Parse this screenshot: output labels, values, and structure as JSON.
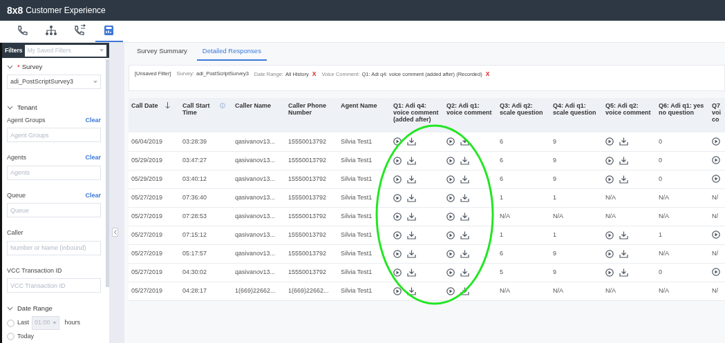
{
  "app_bar": {
    "logo": "8x8",
    "product": "Customer Experience"
  },
  "nav_icons": [
    {
      "kind": "phone",
      "selected": false
    },
    {
      "kind": "org",
      "selected": false
    },
    {
      "kind": "phone-transfer",
      "selected": false
    },
    {
      "kind": "report",
      "selected": true
    }
  ],
  "filters": {
    "label": "Filters",
    "saved_filters": {
      "placeholder": "My Saved Filters"
    },
    "sections": [
      {
        "title": "Survey",
        "required_mark": "*",
        "expanded": true,
        "fields": [
          {
            "kind": "select",
            "value": "adi_PostScriptSurvey3"
          }
        ]
      },
      {
        "title": "Tenant",
        "expanded": true,
        "fields": [
          {
            "kind": "input",
            "label": "Agent Groups",
            "clear": "Clear",
            "placeholder": "Agent Groups"
          },
          {
            "kind": "input",
            "label": "Agents",
            "clear": "Clear",
            "placeholder": "Agents"
          },
          {
            "kind": "input",
            "label": "Queue",
            "clear": "Clear",
            "placeholder": "Queue"
          },
          {
            "kind": "input",
            "label": "Caller",
            "placeholder": "Number or Name (inbound)"
          },
          {
            "kind": "input",
            "label": "VCC Transaction ID",
            "placeholder": "VCC Transaction ID"
          }
        ]
      },
      {
        "title": "Date Range",
        "expanded": true,
        "fields": [
          {
            "kind": "radio",
            "label": "Last",
            "selected": false,
            "select_value": "01:00",
            "unit": "hours"
          },
          {
            "kind": "radio",
            "label": "Today",
            "selected": false
          }
        ]
      }
    ]
  },
  "tabs": [
    {
      "label": "Survey Summary",
      "selected": false
    },
    {
      "label": "Detailed Responses",
      "selected": true
    }
  ],
  "filter_summary": [
    {
      "kind": "status",
      "text": "[Unsaved Filter]"
    },
    {
      "kind": "chip",
      "label": "Survey:",
      "value": "adi_PostScriptSurvey3"
    },
    {
      "kind": "chip",
      "label": "Date Range:",
      "value": "All History",
      "remove": "X"
    },
    {
      "kind": "chip",
      "label": "Voice Comment:",
      "value": "Q1: Adi q4: voice comment (added after) (Recorded)",
      "remove": "X"
    }
  ],
  "table": {
    "columns": [
      {
        "label": "Call Date",
        "sorted": true
      },
      {
        "label": "Call Start Time",
        "info": true
      },
      {
        "label": "Caller Name"
      },
      {
        "label": "Caller Phone Number"
      },
      {
        "label": "Agent Name"
      },
      {
        "label": "Q1: Adi q4: voice comment (added after)"
      },
      {
        "label": "Q2: Adi q1: voice comment"
      },
      {
        "label": "Q3: Adi q2: scale question"
      },
      {
        "label": "Q4: Adi q1: scale question"
      },
      {
        "label": "Q5: Adi q2: voice comment"
      },
      {
        "label": "Q6: Adi q1: yes no question"
      },
      {
        "label": "Q7 voi co"
      }
    ],
    "rows": [
      {
        "cells": [
          "06/04/2019",
          "03:28:39",
          "qasivanov13...",
          "15550013792",
          "Silvia Test1"
        ],
        "answers": [
          {
            "kind": "audio"
          },
          {
            "kind": "audio"
          },
          {
            "kind": "text",
            "text": "6"
          },
          {
            "kind": "text",
            "text": "9"
          },
          {
            "kind": "audio"
          },
          {
            "kind": "text",
            "text": "0"
          },
          {
            "kind": "play"
          }
        ]
      },
      {
        "cells": [
          "05/29/2019",
          "03:47:27",
          "qasivanov13...",
          "15550013792",
          "Silvia Test1"
        ],
        "answers": [
          {
            "kind": "audio"
          },
          {
            "kind": "audio"
          },
          {
            "kind": "text",
            "text": "6"
          },
          {
            "kind": "text",
            "text": "9"
          },
          {
            "kind": "audio"
          },
          {
            "kind": "text",
            "text": "0"
          },
          {
            "kind": "play"
          }
        ]
      },
      {
        "cells": [
          "05/29/2019",
          "03:40:12",
          "qasivanov13...",
          "15550013792",
          "Silvia Test1"
        ],
        "answers": [
          {
            "kind": "audio"
          },
          {
            "kind": "audio"
          },
          {
            "kind": "text",
            "text": "6"
          },
          {
            "kind": "text",
            "text": "9"
          },
          {
            "kind": "audio"
          },
          {
            "kind": "text",
            "text": "0"
          },
          {
            "kind": "play"
          }
        ]
      },
      {
        "cells": [
          "05/27/2019",
          "07:36:40",
          "qasivanov13...",
          "15550013792",
          "Silvia Test1"
        ],
        "answers": [
          {
            "kind": "audio"
          },
          {
            "kind": "audio"
          },
          {
            "kind": "text",
            "text": "1"
          },
          {
            "kind": "text",
            "text": "1"
          },
          {
            "kind": "text",
            "text": "N/A"
          },
          {
            "kind": "text",
            "text": "N/A"
          },
          {
            "kind": "text",
            "text": "N/"
          }
        ]
      },
      {
        "cells": [
          "05/27/2019",
          "07:28:53",
          "qasivanov13...",
          "15550013792",
          "Silvia Test1"
        ],
        "answers": [
          {
            "kind": "audio"
          },
          {
            "kind": "audio"
          },
          {
            "kind": "text",
            "text": "N/A"
          },
          {
            "kind": "text",
            "text": "N/A"
          },
          {
            "kind": "text",
            "text": "N/A"
          },
          {
            "kind": "text",
            "text": "N/A"
          },
          {
            "kind": "text",
            "text": "N/"
          }
        ]
      },
      {
        "cells": [
          "05/27/2019",
          "07:15:12",
          "qasivanov13...",
          "15550013792",
          "Silvia Test1"
        ],
        "answers": [
          {
            "kind": "audio"
          },
          {
            "kind": "audio"
          },
          {
            "kind": "text",
            "text": "1"
          },
          {
            "kind": "text",
            "text": "1"
          },
          {
            "kind": "audio"
          },
          {
            "kind": "text",
            "text": "1"
          },
          {
            "kind": "play"
          }
        ]
      },
      {
        "cells": [
          "05/27/2019",
          "05:17:57",
          "qasivanov13...",
          "15550013792",
          "Silvia Test1"
        ],
        "answers": [
          {
            "kind": "audio"
          },
          {
            "kind": "audio"
          },
          {
            "kind": "text",
            "text": "6"
          },
          {
            "kind": "text",
            "text": "9"
          },
          {
            "kind": "audio"
          },
          {
            "kind": "text",
            "text": "N/A"
          },
          {
            "kind": "text",
            "text": "N/"
          }
        ]
      },
      {
        "cells": [
          "05/27/2019",
          "04:30:02",
          "qasivanov13...",
          "15550013792",
          "Silvia Test1"
        ],
        "answers": [
          {
            "kind": "audio"
          },
          {
            "kind": "audio"
          },
          {
            "kind": "text",
            "text": "5"
          },
          {
            "kind": "text",
            "text": "9"
          },
          {
            "kind": "audio"
          },
          {
            "kind": "text",
            "text": "0"
          },
          {
            "kind": "play"
          }
        ]
      },
      {
        "cells": [
          "05/27/2019",
          "04:28:17",
          "1(669)22662...",
          "1(669)22662...",
          "Silvia Test1"
        ],
        "answers": [
          {
            "kind": "audio"
          },
          {
            "kind": "audio"
          },
          {
            "kind": "text",
            "text": "N/A"
          },
          {
            "kind": "text",
            "text": "N/A"
          },
          {
            "kind": "text",
            "text": "N/A"
          },
          {
            "kind": "text",
            "text": "N/A"
          },
          {
            "kind": "text",
            "text": "N/"
          }
        ]
      }
    ]
  },
  "annotation": {
    "kind": "ellipse",
    "color": "#22e622"
  }
}
